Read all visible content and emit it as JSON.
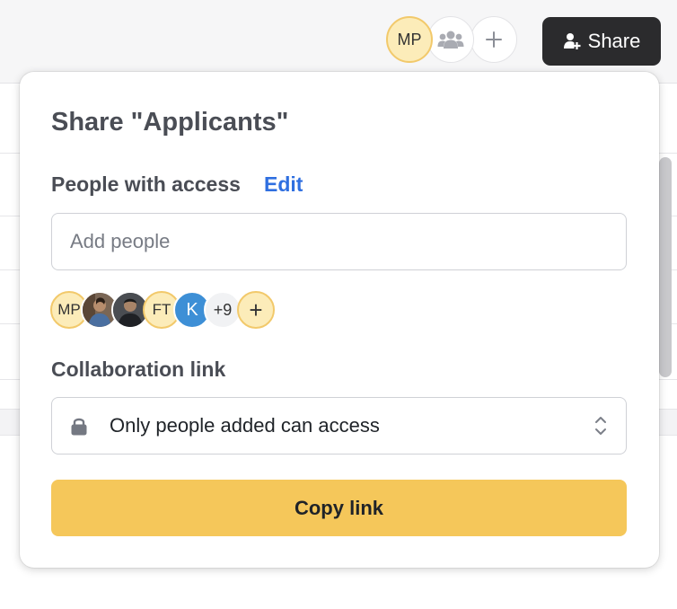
{
  "header": {
    "user_initials": "MP",
    "group_icon": "group-icon",
    "add_icon": "plus-icon",
    "share_button_label": "Share",
    "share_button_icon": "add-person-icon"
  },
  "share_dialog": {
    "title": "Share \"Applicants\"",
    "people_with_access_label": "People with access",
    "edit_label": "Edit",
    "add_people_placeholder": "Add people",
    "collaborators": [
      {
        "type": "initials",
        "label": "MP"
      },
      {
        "type": "photo",
        "label": ""
      },
      {
        "type": "photo",
        "label": ""
      },
      {
        "type": "initials",
        "label": "FT"
      },
      {
        "type": "initials",
        "label": "K"
      },
      {
        "type": "overflow",
        "label": "+9"
      },
      {
        "type": "add",
        "label": "+"
      }
    ],
    "collaboration_link_label": "Collaboration link",
    "link_access_value": "Only people added can access",
    "link_access_icon": "lock-icon",
    "copy_button_label": "Copy link"
  },
  "colors": {
    "accent_yellow": "#f5c75a",
    "link_blue": "#2f6fe0",
    "dark_button": "#2b2b2d"
  }
}
